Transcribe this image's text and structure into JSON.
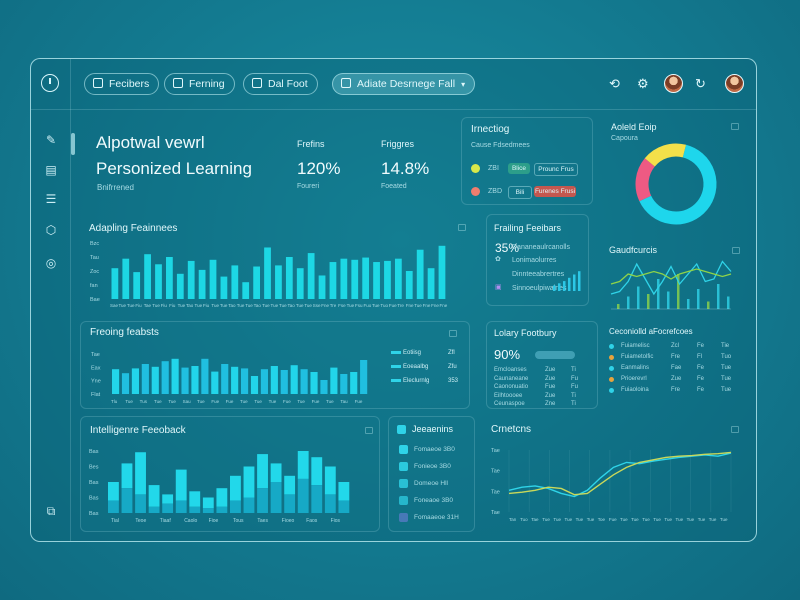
{
  "topbar": {
    "tabs": [
      {
        "label": "Fecibers"
      },
      {
        "label": "Ferning"
      },
      {
        "label": "Dal Foot"
      },
      {
        "label": "Adiate Desrnege Fall",
        "active": true
      }
    ]
  },
  "overview": {
    "title_line1": "Alpotwal vewrl",
    "title_line2": "Personized Learning",
    "caption": "Bnifrrened",
    "metric1": {
      "label": "Frefins",
      "value": "120%",
      "sub": "Foureri"
    },
    "metric2": {
      "label": "Friggres",
      "value": "14.8%",
      "sub": "Foeated"
    }
  },
  "inspection": {
    "title": "Irnectiog",
    "header": "Cause Fdsedmees",
    "rows": [
      {
        "color": "#d8e84a",
        "code": "ZBI",
        "chip1": "Blice",
        "chip2": "Prounc Frus",
        "chip_color": "#2c9e8a"
      },
      {
        "color": "#ef7d6e",
        "code": "ZBD",
        "chip1": "Bili",
        "chip2": "Furenes Frusi",
        "chip_color": "#c4574f"
      }
    ]
  },
  "donut_panel": {
    "title": "Aoleld Eoip",
    "subtitle": "Capoura",
    "slices": [
      {
        "value": 64,
        "color": "#1ed6ec"
      },
      {
        "value": 18,
        "color": "#ee5a83"
      },
      {
        "value": 18,
        "color": "#f4e04a"
      }
    ]
  },
  "adapting": {
    "title": "Adapling Feainnees",
    "ylabels": [
      "Bae",
      "fan",
      "Zoc",
      "Tau",
      "Bzc"
    ],
    "bars": [
      0.55,
      0.72,
      0.48,
      0.8,
      0.62,
      0.75,
      0.45,
      0.68,
      0.52,
      0.7,
      0.4,
      0.6,
      0.3,
      0.58,
      0.92,
      0.6,
      0.75,
      0.55,
      0.82,
      0.42,
      0.66,
      0.72,
      0.7,
      0.74,
      0.66,
      0.68,
      0.72,
      0.5,
      0.88,
      0.55,
      0.95
    ],
    "xlabels": [
      "Sae",
      "Tue",
      "Tue",
      "Fiu",
      "Tae",
      "Tue",
      "Fiu",
      "Fiu",
      "Tue",
      "Tao",
      "Tue",
      "Fiu",
      "Tue",
      "Tue",
      "Tao",
      "Tue",
      "Tue",
      "Tao",
      "Tue",
      "Tue",
      "Tue",
      "Tao",
      "Tue",
      "Tue",
      "Sse",
      "Fne",
      "Tre",
      "Fse",
      "Tue",
      "Fsu",
      "Fuo",
      "Tue",
      "Tuo",
      "Fue",
      "Tre",
      "Fne",
      "Tue",
      "Fne",
      "Fne",
      "Fne"
    ]
  },
  "fishing": {
    "title": "Frailing Feeibars",
    "big": "35%",
    "rows": [
      "Dananeaulrcanolls",
      "Lonimaolurres",
      "Dinnteeabrertres",
      "Sinnoeulpiwalnes"
    ],
    "bars": [
      0.25,
      0.35,
      0.45,
      0.6,
      0.75,
      0.9
    ]
  },
  "gauge": {
    "title": "Gaudfcurcis",
    "lines": [
      [
        0.3,
        0.35,
        0.55,
        0.9,
        0.6,
        0.3,
        0.55,
        0.85,
        0.5,
        0.7,
        0.9,
        0.55,
        0.6,
        0.95,
        0.75
      ],
      [
        0.5,
        0.55,
        0.7,
        0.65,
        0.7,
        0.75,
        0.7,
        0.6,
        0.7,
        0.75,
        0.8,
        0.75,
        0.7,
        0.65,
        0.7
      ]
    ],
    "bars": [
      0.1,
      0.25,
      0.45,
      0.3,
      0.6,
      0.35,
      0.7,
      0.2,
      0.4,
      0.15,
      0.5,
      0.25
    ]
  },
  "tracking": {
    "title": "Freoing feabsts",
    "ylabels": [
      "Flat",
      "Yne",
      "Eax",
      "Tae"
    ],
    "bars": [
      0.62,
      0.52,
      0.64,
      0.75,
      0.68,
      0.82,
      0.88,
      0.66,
      0.7,
      0.88,
      0.56,
      0.75,
      0.68,
      0.64,
      0.45,
      0.62,
      0.7,
      0.6,
      0.72,
      0.62,
      0.55,
      0.35,
      0.66,
      0.5,
      0.55,
      0.85
    ],
    "xlabels": [
      "Tlu",
      "Tue",
      "Tus",
      "Tue",
      "Tue",
      "Sau",
      "Tue",
      "Fue",
      "Fue",
      "Tue",
      "Tue",
      "Tue",
      "Fue",
      "Tue",
      "Fue",
      "Tue",
      "Tau",
      "Fue"
    ],
    "legend": [
      {
        "label": "Eotiisg",
        "value": "Zfl"
      },
      {
        "label": "Eoeaalbg",
        "value": "Zfu"
      },
      {
        "label": "Eleclurnlg",
        "value": "353"
      }
    ]
  },
  "learning": {
    "title": "Lolary Footbury",
    "big": "90%",
    "rows": [
      {
        "label": "Emcloanses",
        "v1": "Zue",
        "v2": "Ti"
      },
      {
        "label": "Caunaneane",
        "v1": "Zue",
        "v2": "Fu"
      },
      {
        "label": "Caononuatio",
        "v1": "Fue",
        "v2": "Fu"
      },
      {
        "label": "Eilhtoooee",
        "v1": "Zue",
        "v2": "Ti"
      },
      {
        "label": "Ceunaspoe",
        "v1": "Zne",
        "v2": "Ti"
      }
    ]
  },
  "conditional": {
    "title": "Ceconiolld aFocrefcoes",
    "rows": [
      {
        "label": "Fuiamelisc",
        "v1": "Zcl",
        "v2": "Fe",
        "v3": "Tie",
        "dot": "#2fd3e8"
      },
      {
        "label": "Fuiametolfic",
        "v1": "Fre",
        "v2": "Fl",
        "v3": "Tuo",
        "dot": "#e6a33d"
      },
      {
        "label": "Eanmalins",
        "v1": "Fae",
        "v2": "Fe",
        "v3": "Tue",
        "dot": "#2fd3e8"
      },
      {
        "label": "Prioerevrl",
        "v1": "Zue",
        "v2": "Fe",
        "v3": "Tue",
        "dot": "#e6a33d"
      },
      {
        "label": "Fuiaoloina",
        "v1": "Fre",
        "v2": "Fe",
        "v3": "Tue",
        "dot": "#2fd3e8"
      }
    ]
  },
  "intelligence": {
    "title": "Intelligenre Feeoback",
    "ylabels": [
      "Bas",
      "Bas",
      "Bas",
      "Bes",
      "Bas"
    ],
    "bars": [
      [
        0.5,
        0.2
      ],
      [
        0.8,
        0.4
      ],
      [
        0.98,
        0.3
      ],
      [
        0.45,
        0.1
      ],
      [
        0.3,
        0.15
      ],
      [
        0.7,
        0.2
      ],
      [
        0.35,
        0.1
      ],
      [
        0.25,
        0.08
      ],
      [
        0.4,
        0.1
      ],
      [
        0.6,
        0.2
      ],
      [
        0.75,
        0.25
      ],
      [
        0.95,
        0.4
      ],
      [
        0.8,
        0.5
      ],
      [
        0.6,
        0.3
      ],
      [
        1.0,
        0.55
      ],
      [
        0.9,
        0.45
      ],
      [
        0.75,
        0.3
      ],
      [
        0.5,
        0.2
      ]
    ],
    "xlabels": [
      "Tial",
      "Teoe",
      "Tiaaf",
      "Caolo",
      "Fioe",
      "Tous",
      "Taes",
      "Fioeo",
      "Faos",
      "Fios"
    ]
  },
  "legend_panel": {
    "title": "Jeeaenins",
    "items": [
      "Fomaeoe 3B0",
      "Fonieoe 3B0",
      "Domeoe Hll",
      "Foneaoe 3B0",
      "Fomaaeoe 31H"
    ]
  },
  "emotions": {
    "title": "Crnetcns",
    "ylabels": [
      "Tae",
      "Tae",
      "Tae",
      "Tae"
    ],
    "series": [
      [
        0.35,
        0.4,
        0.42,
        0.38,
        0.3,
        0.25,
        0.35,
        0.55,
        0.72,
        0.8,
        0.78,
        0.82,
        0.85,
        0.88,
        0.9,
        0.92,
        0.9,
        0.95
      ],
      [
        0.3,
        0.32,
        0.35,
        0.4,
        0.38,
        0.28,
        0.3,
        0.45,
        0.6,
        0.72,
        0.8,
        0.84,
        0.88,
        0.9,
        0.91,
        0.93,
        0.94,
        0.96
      ]
    ],
    "xlabels": [
      "Tan",
      "Tuo",
      "Tae",
      "Tue",
      "Tue",
      "Tue",
      "Tue",
      "Tue",
      "Toe",
      "Fue",
      "Tue",
      "Tue",
      "Tue",
      "Tue",
      "Tue",
      "Tue",
      "Tue",
      "Tue",
      "Tue",
      "Tue"
    ]
  }
}
